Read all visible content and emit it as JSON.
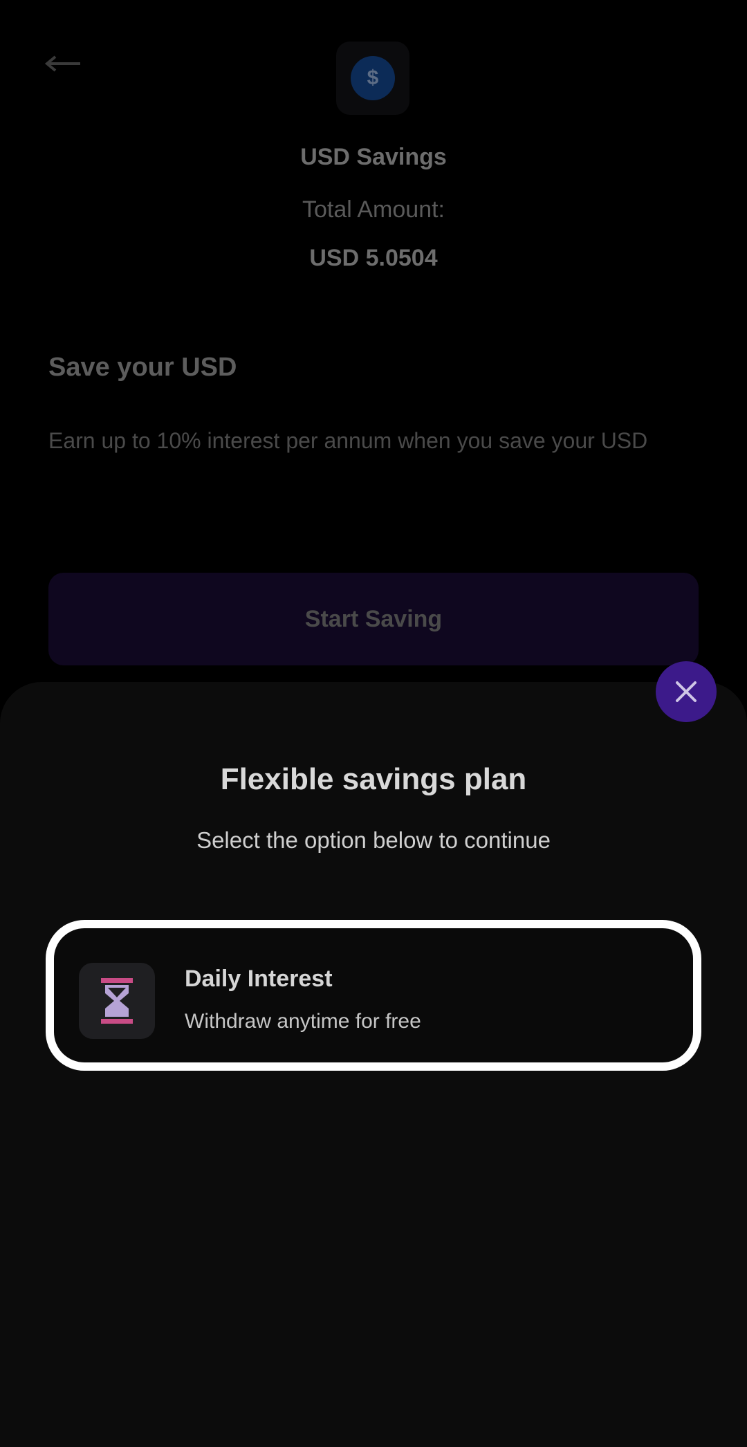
{
  "background": {
    "account_name": "USD Savings",
    "total_label": "Total Amount:",
    "total_value": "USD 5.0504",
    "save_title": "Save your USD",
    "save_description": "Earn up to 10% interest per annum when you save your USD",
    "start_button": "Start Saving",
    "logo_symbol": "$"
  },
  "sheet": {
    "title": "Flexible savings plan",
    "subtitle": "Select the option below to continue",
    "options": [
      {
        "title": "Daily Interest",
        "subtitle": "Withdraw anytime for free",
        "icon": "hourglass-icon"
      }
    ]
  },
  "colors": {
    "accent": "#3c1a8a",
    "icon_pink": "#c94c86",
    "icon_lavender": "#b6a3d6"
  }
}
